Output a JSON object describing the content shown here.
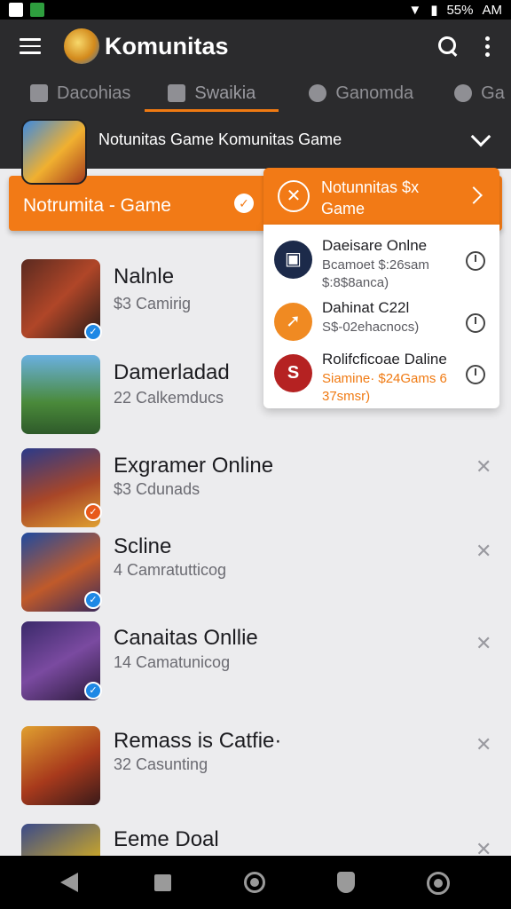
{
  "status_bar": {
    "battery": "55%",
    "time": "AM"
  },
  "app_bar": {
    "title": "Komunitas"
  },
  "tabs": [
    {
      "label": "Dacohias",
      "icon": "check-square-icon"
    },
    {
      "label": "Swaikia",
      "icon": "controller-icon"
    },
    {
      "label": "Ganomda",
      "icon": "check-circle-icon"
    },
    {
      "label": "Ga",
      "icon": "check-circle-icon"
    }
  ],
  "community": {
    "name": "Notunitas Game Komunitas Game"
  },
  "orange_bar": {
    "label": "Notrumita - Game"
  },
  "popup": {
    "title": "Notunnitas $x Game",
    "items": [
      {
        "title": "Daeisare Onlne",
        "sub": "Bcamoet $:26sam $:8$8ancа)",
        "icon": "briefcase-icon",
        "color": "#1c2a4a"
      },
      {
        "title": "Dahinat C22l",
        "sub": "S$-02ehacnocs)",
        "icon": "arrow-icon",
        "color": "#f08a22"
      },
      {
        "title": "Rolifcficoae Daline",
        "sub": "Siamine· $24Gams 6 37smsr)",
        "icon": "s-logo-icon",
        "color": "#b52222"
      }
    ]
  },
  "list": [
    {
      "title": "Nalnle",
      "sub": "$3 Camirig",
      "badge": "blue"
    },
    {
      "title": "Damerladad",
      "sub": "22 Calkemducs",
      "badge": "none"
    },
    {
      "title": "Exgramer Online",
      "sub": "$3 Cdunads",
      "badge": "orange"
    },
    {
      "title": "Scline",
      "sub": "4 Camratutticog",
      "badge": "blue"
    },
    {
      "title": "Canaitas Onllie",
      "sub": "14 Camatunicog",
      "badge": "blue"
    },
    {
      "title": "Remass is Catfie·",
      "sub": "32 Casunting",
      "badge": "none"
    },
    {
      "title": "Eeme Doal",
      "sub": "",
      "badge": "none"
    }
  ],
  "close_glyph": "✕"
}
